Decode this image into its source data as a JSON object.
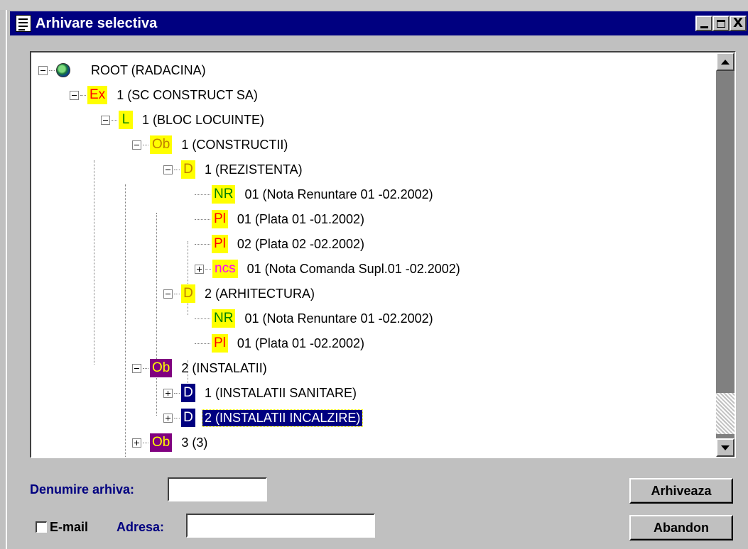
{
  "window": {
    "title": "Arhivare selectiva"
  },
  "tree": [
    {
      "id": "root",
      "badge": "",
      "label": "ROOT (RADACINA)",
      "expander": "minus"
    },
    {
      "id": "ex",
      "badge": "Ex",
      "label": "1 (SC CONSTRUCT SA)",
      "expander": "minus"
    },
    {
      "id": "l",
      "badge": "L",
      "label": "1 (BLOC LOCUINTE)",
      "expander": "minus"
    },
    {
      "id": "ob1",
      "badge": "Ob",
      "label": "1 (CONSTRUCTII)",
      "expander": "minus"
    },
    {
      "id": "d1",
      "badge": "D",
      "label": "1 (REZISTENTA)",
      "expander": "minus"
    },
    {
      "id": "nr1",
      "badge": "NR",
      "label": "01 (Nota Renuntare 01 -02.2002)",
      "expander": "none"
    },
    {
      "id": "pl1",
      "badge": "Pl",
      "label": "01 (Plata 01 -01.2002)",
      "expander": "none"
    },
    {
      "id": "pl2",
      "badge": "Pl",
      "label": "02 (Plata 02 -02.2002)",
      "expander": "none"
    },
    {
      "id": "ncs1",
      "badge": "ncs",
      "label": "01 (Nota Comanda Supl.01 -02.2002)",
      "expander": "plus"
    },
    {
      "id": "d2",
      "badge": "D",
      "label": "2 (ARHITECTURA)",
      "expander": "minus"
    },
    {
      "id": "nr2",
      "badge": "NR",
      "label": "01 (Nota Renuntare 01 -02.2002)",
      "expander": "none"
    },
    {
      "id": "pl3",
      "badge": "Pl",
      "label": "01 (Plata 01 -02.2002)",
      "expander": "none"
    },
    {
      "id": "ob2",
      "badge": "Ob",
      "label": "2 (INSTALATII)",
      "expander": "minus"
    },
    {
      "id": "d3",
      "badge": "D",
      "label": "1 (INSTALATII SANITARE)",
      "expander": "plus"
    },
    {
      "id": "d4",
      "badge": "D",
      "label": "2 (INSTALATII INCALZIRE)",
      "expander": "plus",
      "selected": true
    },
    {
      "id": "ob3",
      "badge": "Ob",
      "label": "3 (3)",
      "expander": "plus"
    }
  ],
  "badge_colors": {
    "Ex": {
      "bg": "#ffff00",
      "fg": "#ff0000"
    },
    "L": {
      "bg": "#ffff00",
      "fg": "#008000"
    },
    "Ob_yellow": {
      "bg": "#ffff00",
      "fg": "#c08000"
    },
    "D_yellow": {
      "bg": "#ffff00",
      "fg": "#c08000"
    },
    "NR": {
      "bg": "#ffff00",
      "fg": "#008000"
    },
    "Pl": {
      "bg": "#ffff00",
      "fg": "#ff0000"
    },
    "ncs": {
      "bg": "#ffff00",
      "fg": "#ff00ff"
    },
    "Ob_purple": {
      "bg": "#800080",
      "fg": "#ffff00"
    },
    "D_navy": {
      "bg": "#000080",
      "fg": "#ffffff"
    }
  },
  "form": {
    "archive_name_label": "Denumire arhiva:",
    "archive_name_value": "",
    "email_checkbox_label": "E-mail",
    "email_checked": false,
    "address_label": "Adresa:",
    "address_value": ""
  },
  "buttons": {
    "archive": "Arhiveaza",
    "cancel": "Abandon"
  },
  "titlebar_buttons": {
    "close_glyph": "X"
  }
}
